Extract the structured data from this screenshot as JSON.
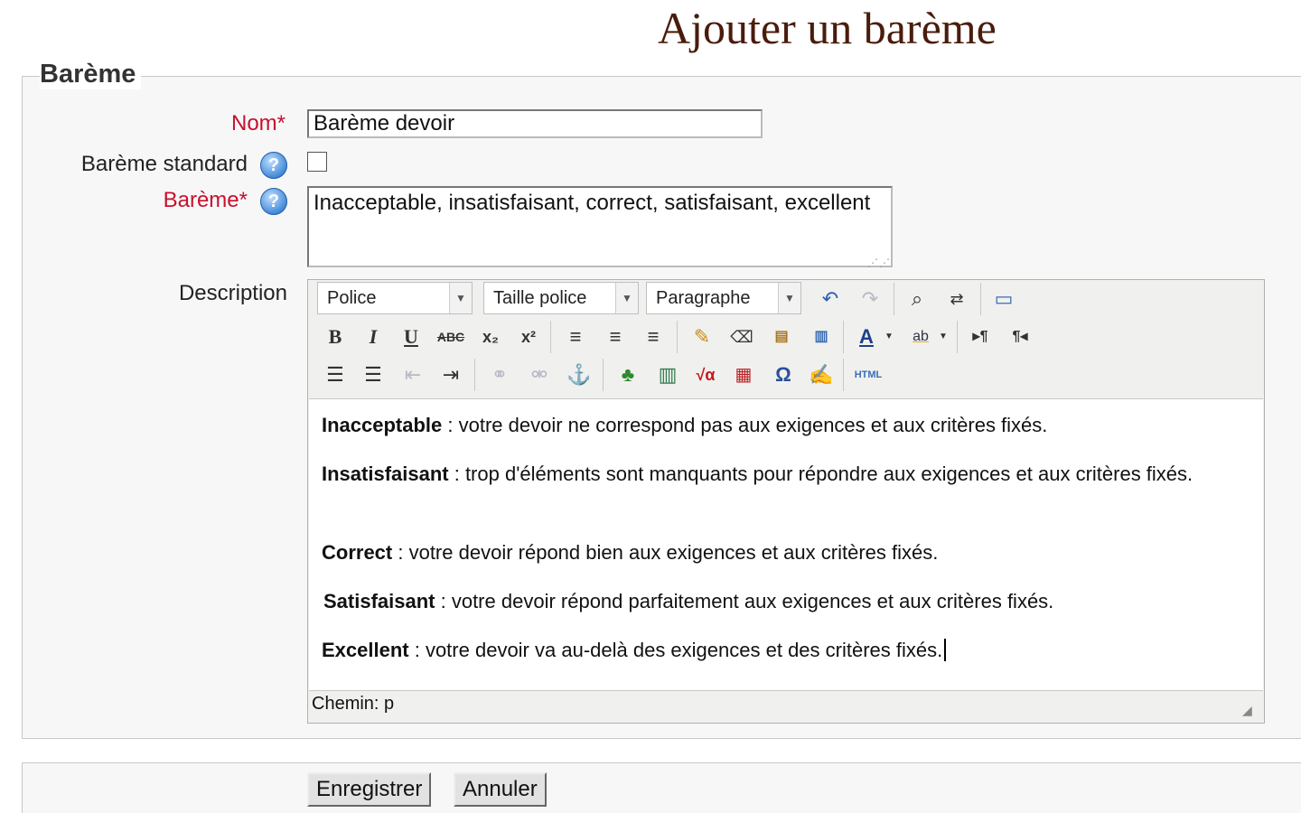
{
  "page_title": "Ajouter un barème",
  "fieldset": {
    "legend": "Barème"
  },
  "form": {
    "name_label": "Nom",
    "required_mark": "*",
    "name_value": "Barème devoir",
    "standard_label": "Barème standard",
    "standard_checked": false,
    "scale_label": "Barème",
    "scale_value": "Inacceptable, insatisfaisant, correct, satisfaisant, excellent",
    "description_label": "Description"
  },
  "editor": {
    "font_select": "Police",
    "size_select": "Taille police",
    "format_select": "Paragraphe",
    "toolbar_row1": [
      {
        "name": "undo-icon",
        "glyph": "↶"
      },
      {
        "name": "redo-icon",
        "glyph": "↷"
      },
      {
        "name": "find-icon",
        "glyph": "🔍"
      },
      {
        "name": "replace-icon",
        "glyph": "⇄"
      },
      {
        "name": "fullscreen-icon",
        "glyph": "▭"
      }
    ],
    "toolbar_row2": [
      {
        "name": "bold-icon",
        "glyph": "B"
      },
      {
        "name": "italic-icon",
        "glyph": "I"
      },
      {
        "name": "underline-icon",
        "glyph": "U"
      },
      {
        "name": "strikethrough-icon",
        "glyph": "ABC"
      },
      {
        "name": "subscript-icon",
        "glyph": "x₂"
      },
      {
        "name": "superscript-icon",
        "glyph": "x²"
      },
      {
        "name": "align-left-icon",
        "glyph": "≡"
      },
      {
        "name": "align-center-icon",
        "glyph": "≡"
      },
      {
        "name": "align-right-icon",
        "glyph": "≡"
      },
      {
        "name": "cleanup-icon",
        "glyph": "✎"
      },
      {
        "name": "eraser-icon",
        "glyph": "⌫"
      },
      {
        "name": "paste-text-icon",
        "glyph": "📋"
      },
      {
        "name": "paste-word-icon",
        "glyph": "📋"
      },
      {
        "name": "text-color-icon",
        "glyph": "A"
      },
      {
        "name": "highlight-color-icon",
        "glyph": "ab"
      },
      {
        "name": "ltr-icon",
        "glyph": "▸¶"
      },
      {
        "name": "rtl-icon",
        "glyph": "¶◂"
      }
    ],
    "toolbar_row3": [
      {
        "name": "bullet-list-icon",
        "glyph": "☰"
      },
      {
        "name": "numbered-list-icon",
        "glyph": "☰"
      },
      {
        "name": "outdent-icon",
        "glyph": "⇤"
      },
      {
        "name": "indent-icon",
        "glyph": "⇥"
      },
      {
        "name": "link-icon",
        "glyph": "⛓"
      },
      {
        "name": "unlink-icon",
        "glyph": "⛓"
      },
      {
        "name": "anchor-icon",
        "glyph": "⚓"
      },
      {
        "name": "image-icon",
        "glyph": "🌳"
      },
      {
        "name": "media-icon",
        "glyph": "🎞"
      },
      {
        "name": "equation-icon",
        "glyph": "√α"
      },
      {
        "name": "table-icon",
        "glyph": "▦"
      },
      {
        "name": "special-char-icon",
        "glyph": "Ω"
      },
      {
        "name": "spellcheck-icon",
        "glyph": "✍"
      },
      {
        "name": "html-icon",
        "glyph": "HTML"
      }
    ],
    "content": [
      {
        "term": "Inacceptable",
        "text": " : votre devoir ne correspond pas aux exigences et aux critères fixés."
      },
      {
        "term": "Insatisfaisant",
        "text": " : trop d'éléments sont manquants pour répondre aux exigences et aux critères fixés."
      },
      {
        "term": "Correct",
        "text": " : votre devoir répond bien aux exigences et aux critères fixés."
      },
      {
        "term": "Satisfaisant",
        "text": " : votre devoir répond parfaitement aux exigences et aux critères fixés."
      },
      {
        "term": "Excellent",
        "text": " : votre devoir va au-delà des exigences et des critères fixés."
      }
    ],
    "path_label": "Chemin: p"
  },
  "actions": {
    "save_label": "Enregistrer",
    "cancel_label": "Annuler"
  }
}
